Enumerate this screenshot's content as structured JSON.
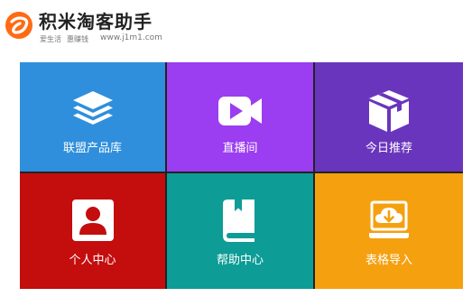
{
  "header": {
    "title": "积米淘客助手",
    "slogan_part1": "爱生活",
    "slogan_part2": "惠赚钱",
    "website": "www.j1m1.com",
    "logo_icon": "jimi-logo-icon",
    "brand_color": "#ff6a13"
  },
  "tiles": [
    {
      "label": "联盟产品库",
      "icon": "layers-icon",
      "color": "#2f8fdc"
    },
    {
      "label": "直播间",
      "icon": "video-camera-icon",
      "color": "#9b3df0"
    },
    {
      "label": "今日推荐",
      "icon": "package-box-icon",
      "color": "#6a35bd"
    },
    {
      "label": "个人中心",
      "icon": "user-profile-icon",
      "color": "#c40d0d"
    },
    {
      "label": "帮助中心",
      "icon": "help-book-icon",
      "color": "#0d9c96"
    },
    {
      "label": "表格导入",
      "icon": "cloud-import-icon",
      "color": "#f5a00f"
    }
  ]
}
